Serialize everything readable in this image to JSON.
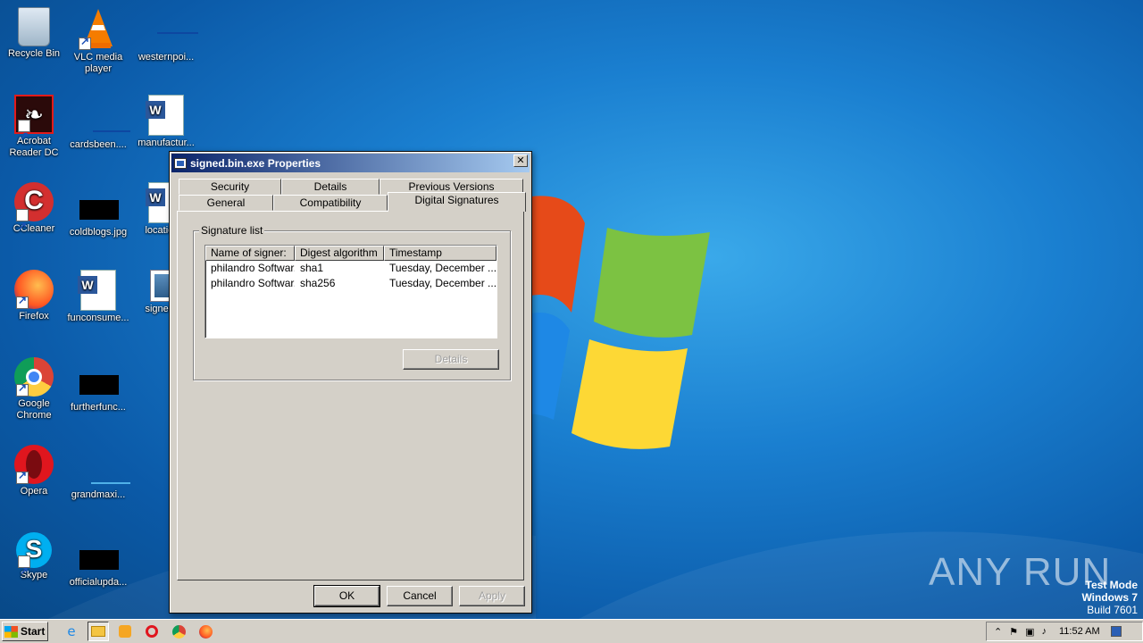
{
  "desktop": {
    "icons": [
      {
        "label": "Recycle Bin",
        "icon": "recycle-bin-icon"
      },
      {
        "label": "VLC media player",
        "icon": "vlc-icon"
      },
      {
        "label": "westernpoi...",
        "icon": "file-icon"
      },
      {
        "label": "Acrobat Reader DC",
        "icon": "acrobat-icon"
      },
      {
        "label": "cardsbeen....",
        "icon": "file-icon"
      },
      {
        "label": "manufactur...",
        "icon": "word-doc-icon"
      },
      {
        "label": "CCleaner",
        "icon": "ccleaner-icon"
      },
      {
        "label": "coldblogs.jpg",
        "icon": "image-file-icon"
      },
      {
        "label": "location...",
        "icon": "word-doc-icon"
      },
      {
        "label": "Firefox",
        "icon": "firefox-icon"
      },
      {
        "label": "funconsume...",
        "icon": "word-doc-icon"
      },
      {
        "label": "signed.l...",
        "icon": "exe-icon"
      },
      {
        "label": "Google Chrome",
        "icon": "chrome-icon"
      },
      {
        "label": "furtherfunc...",
        "icon": "image-file-icon"
      },
      {
        "label": "Opera",
        "icon": "opera-icon"
      },
      {
        "label": "grandmaxi...",
        "icon": "file-icon"
      },
      {
        "label": "Skype",
        "icon": "skype-icon"
      },
      {
        "label": "officialupda...",
        "icon": "image-file-icon"
      }
    ]
  },
  "dialog": {
    "title": "signed.bin.exe Properties",
    "tabs_row1": [
      "Security",
      "Details",
      "Previous Versions"
    ],
    "tabs_row2": [
      "General",
      "Compatibility",
      "Digital Signatures"
    ],
    "active_tab": "Digital Signatures",
    "group_label": "Signature list",
    "columns": [
      "Name of signer:",
      "Digest algorithm",
      "Timestamp"
    ],
    "rows": [
      [
        "philandro Softwar...",
        "sha1",
        "Tuesday, December ..."
      ],
      [
        "philandro Softwar...",
        "sha256",
        "Tuesday, December ..."
      ]
    ],
    "details_button": "Details",
    "ok_button": "OK",
    "cancel_button": "Cancel",
    "apply_button": "Apply"
  },
  "taskbar": {
    "start_label": "Start",
    "pinned": [
      "ie-icon",
      "explorer-icon",
      "media-player-icon",
      "opera-icon",
      "chrome-icon",
      "firefox-icon"
    ],
    "clock": "11:52 AM"
  },
  "watermark": {
    "line1": "Test Mode",
    "line2": "Windows 7",
    "line3": "Build 7601",
    "brand": "ANY RUN"
  }
}
